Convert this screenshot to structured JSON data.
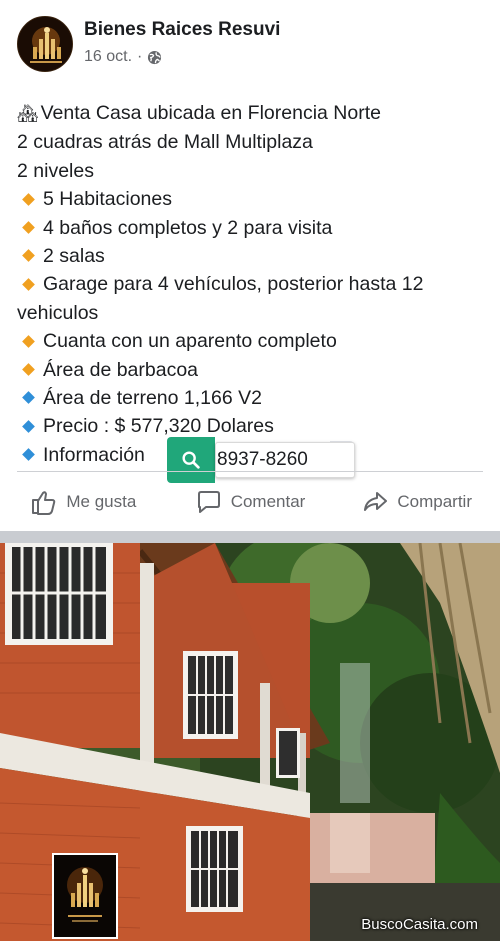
{
  "header": {
    "page_name": "Bienes Raices Resuvi",
    "date": "16 oct.",
    "separator": "·",
    "privacy_icon": "globe-icon"
  },
  "post": {
    "lines": [
      {
        "icon": "house-icon",
        "text": "Venta  Casa ubicada en Florencia Norte"
      },
      {
        "icon": "",
        "text": "2 cuadras atrás de Mall Multiplaza"
      },
      {
        "icon": "",
        "text": "2 niveles"
      },
      {
        "icon": "orange-diamond",
        "text": "5 Habitaciones"
      },
      {
        "icon": "orange-diamond",
        "text": "4 baños completos y 2 para visita"
      },
      {
        "icon": "orange-diamond",
        "text": "2 salas"
      },
      {
        "icon": "orange-diamond",
        "text": "Garage para 4 vehículos, posterior hasta 12 vehiculos"
      },
      {
        "icon": "orange-diamond",
        "text": "Cuanta con un aparento completo"
      },
      {
        "icon": "orange-diamond",
        "text": "Área de barbacoa"
      },
      {
        "icon": "blue-diamond",
        "text": "Área de terreno 1,166 V2"
      },
      {
        "icon": "blue-diamond",
        "text": "Precio : $ 577,320 Dolares"
      },
      {
        "icon": "blue-diamond",
        "text": "Información"
      }
    ],
    "phone": "8937-8260"
  },
  "actions": {
    "like": "Me gusta",
    "comment": "Comentar",
    "share": "Compartir"
  },
  "photo": {
    "watermark": "BuscoCasita.com"
  },
  "colors": {
    "text": "#1c1e21",
    "secondary": "#65676b",
    "lens_green": "#20a77a",
    "diamond_orange": "#f0a020",
    "diamond_blue": "#2f8fd8"
  }
}
